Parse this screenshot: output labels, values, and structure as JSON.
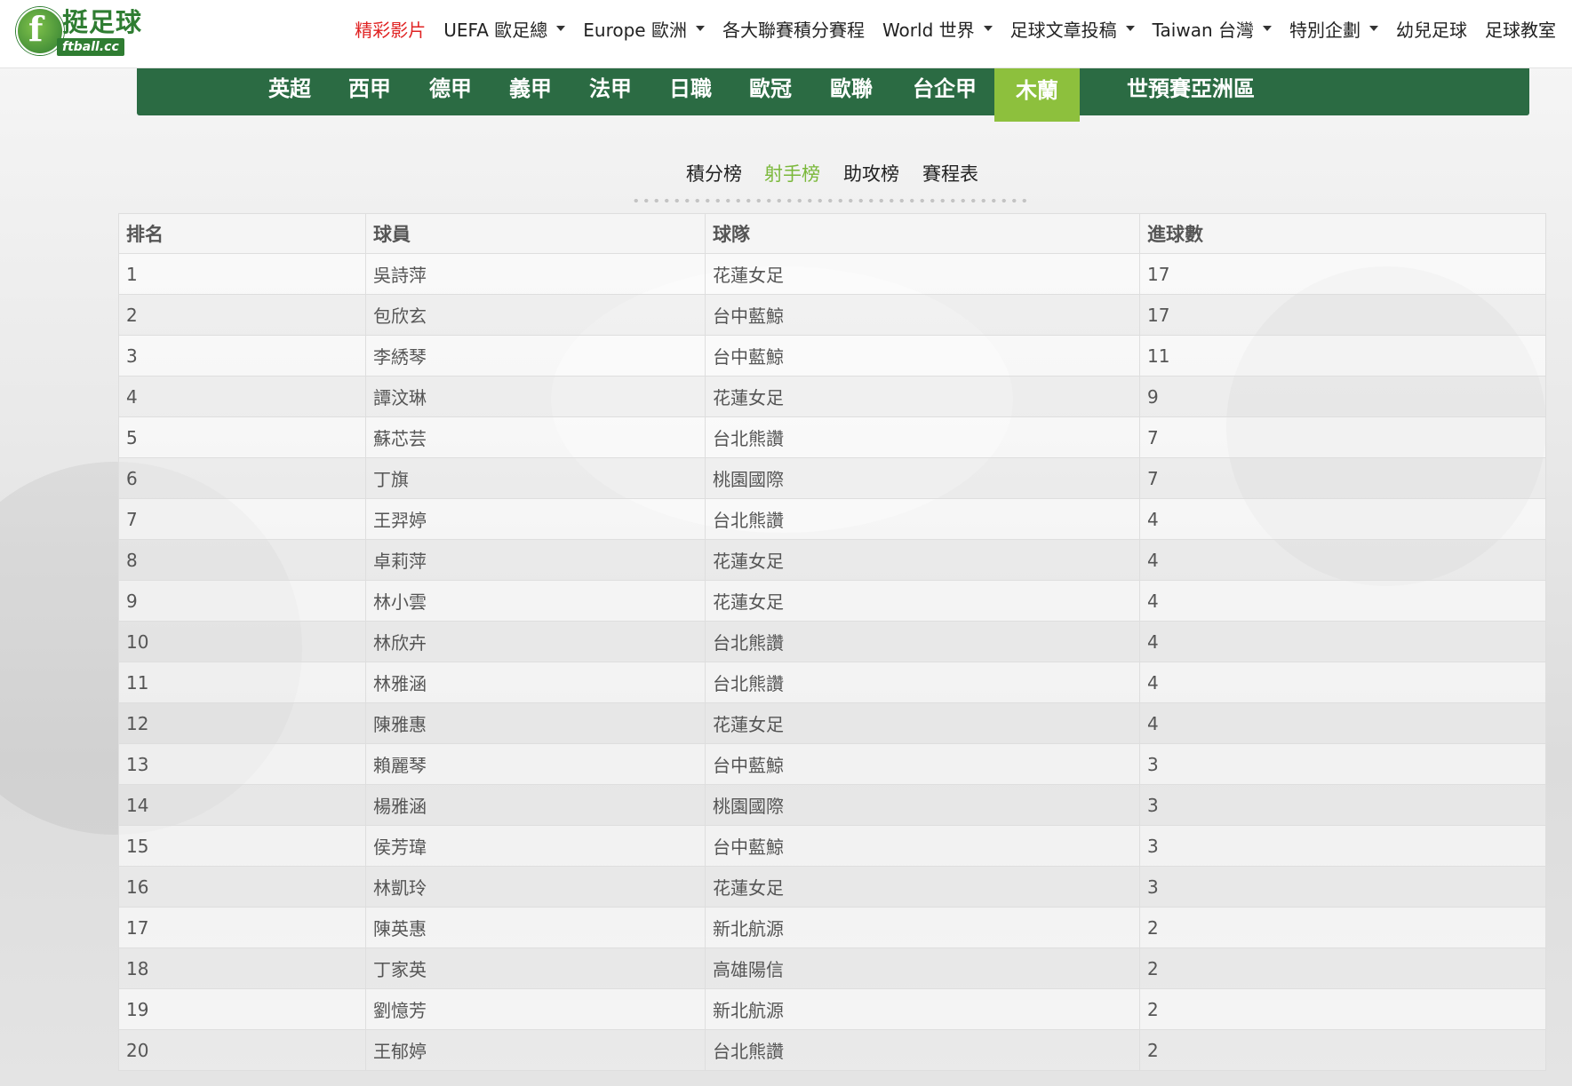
{
  "logo": {
    "cn_text": "挺足球",
    "en_text": "ftball.cc",
    "f_letter": "f"
  },
  "main_nav": [
    {
      "label": "精彩影片",
      "dropdown": false,
      "active": true
    },
    {
      "label": "UEFA 歐足總",
      "dropdown": true,
      "active": false
    },
    {
      "label": "Europe 歐洲",
      "dropdown": true,
      "active": false
    },
    {
      "label": "各大聯賽積分賽程",
      "dropdown": false,
      "active": false
    },
    {
      "label": "World 世界",
      "dropdown": true,
      "active": false
    },
    {
      "label": "足球文章投稿",
      "dropdown": true,
      "active": false
    },
    {
      "label": "Taiwan 台灣",
      "dropdown": true,
      "active": false
    },
    {
      "label": "特別企劃",
      "dropdown": true,
      "active": false
    },
    {
      "label": "幼兒足球",
      "dropdown": false,
      "active": false
    },
    {
      "label": "足球教室",
      "dropdown": false,
      "active": false
    }
  ],
  "league_tabs": [
    {
      "label": "英超",
      "active": false
    },
    {
      "label": "西甲",
      "active": false
    },
    {
      "label": "德甲",
      "active": false
    },
    {
      "label": "義甲",
      "active": false
    },
    {
      "label": "法甲",
      "active": false
    },
    {
      "label": "日職",
      "active": false
    },
    {
      "label": "歐冠",
      "active": false
    },
    {
      "label": "歐聯",
      "active": false
    },
    {
      "label": "台企甲",
      "active": false
    },
    {
      "label": "木蘭",
      "active": true
    },
    {
      "label": "世預賽亞洲區",
      "active": false
    }
  ],
  "sub_tabs": [
    {
      "label": "積分榜",
      "active": false
    },
    {
      "label": "射手榜",
      "active": true
    },
    {
      "label": "助攻榜",
      "active": false
    },
    {
      "label": "賽程表",
      "active": false
    }
  ],
  "table": {
    "headers": {
      "rank": "排名",
      "player": "球員",
      "team": "球隊",
      "goals": "進球數"
    },
    "rows": [
      {
        "rank": "1",
        "player": "吳詩萍",
        "team": "花蓮女足",
        "goals": "17"
      },
      {
        "rank": "2",
        "player": "包欣玄",
        "team": "台中藍鯨",
        "goals": "17"
      },
      {
        "rank": "3",
        "player": "李綉琴",
        "team": "台中藍鯨",
        "goals": "11"
      },
      {
        "rank": "4",
        "player": "譚汶琳",
        "team": "花蓮女足",
        "goals": "9"
      },
      {
        "rank": "5",
        "player": "蘇芯芸",
        "team": "台北熊讚",
        "goals": "7"
      },
      {
        "rank": "6",
        "player": "丁旗",
        "team": "桃園國際",
        "goals": "7"
      },
      {
        "rank": "7",
        "player": "王羿婷",
        "team": "台北熊讚",
        "goals": "4"
      },
      {
        "rank": "8",
        "player": "卓莉萍",
        "team": "花蓮女足",
        "goals": "4"
      },
      {
        "rank": "9",
        "player": "林小雲",
        "team": "花蓮女足",
        "goals": "4"
      },
      {
        "rank": "10",
        "player": "林欣卉",
        "team": "台北熊讚",
        "goals": "4"
      },
      {
        "rank": "11",
        "player": "林雅涵",
        "team": "台北熊讚",
        "goals": "4"
      },
      {
        "rank": "12",
        "player": "陳雅惠",
        "team": "花蓮女足",
        "goals": "4"
      },
      {
        "rank": "13",
        "player": "賴麗琴",
        "team": "台中藍鯨",
        "goals": "3"
      },
      {
        "rank": "14",
        "player": "楊雅涵",
        "team": "桃園國際",
        "goals": "3"
      },
      {
        "rank": "15",
        "player": "侯芳瑋",
        "team": "台中藍鯨",
        "goals": "3"
      },
      {
        "rank": "16",
        "player": "林凱玲",
        "team": "花蓮女足",
        "goals": "3"
      },
      {
        "rank": "17",
        "player": "陳英惠",
        "team": "新北航源",
        "goals": "2"
      },
      {
        "rank": "18",
        "player": "丁家英",
        "team": "高雄陽信",
        "goals": "2"
      },
      {
        "rank": "19",
        "player": "劉憶芳",
        "team": "新北航源",
        "goals": "2"
      },
      {
        "rank": "20",
        "player": "王郁婷",
        "team": "台北熊讚",
        "goals": "2"
      }
    ]
  },
  "colors": {
    "league_bar": "#2b6b43",
    "league_active": "#8dc03d",
    "nav_active": "#e02323",
    "subtab_active": "#7ab83a"
  }
}
